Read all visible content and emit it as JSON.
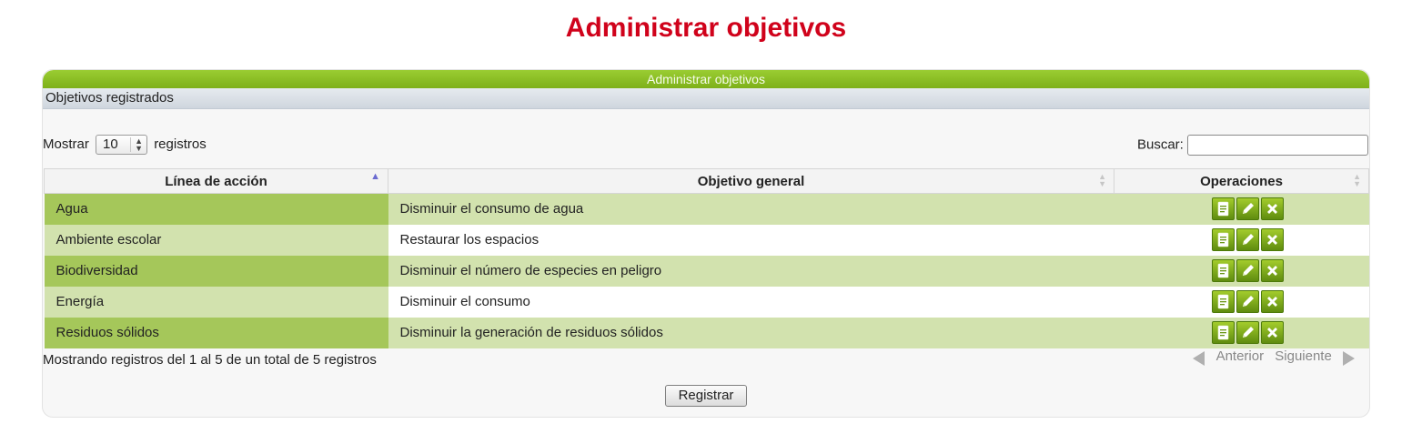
{
  "page": {
    "title": "Administrar objetivos"
  },
  "panel": {
    "header": "Administrar objetivos",
    "subheader": "Objetivos registrados"
  },
  "controls": {
    "show_label": "Mostrar",
    "page_size": "10",
    "records_label": "registros",
    "search_label": "Buscar:",
    "search_value": ""
  },
  "table": {
    "columns": [
      "Línea de acción",
      "Objetivo general",
      "Operaciones"
    ],
    "sorted_column": "Línea de acción",
    "sort_direction": "ascending",
    "rows": [
      {
        "linea": "Agua",
        "objetivo": "Disminuir el consumo de agua"
      },
      {
        "linea": "Ambiente escolar",
        "objetivo": "Restaurar los espacios"
      },
      {
        "linea": "Biodiversidad",
        "objetivo": "Disminuir el número de especies en peligro"
      },
      {
        "linea": "Energía",
        "objetivo": "Disminuir el consumo"
      },
      {
        "linea": "Residuos sólidos",
        "objetivo": "Disminuir la generación de residuos sólidos"
      }
    ],
    "operation_icons": [
      "document-icon",
      "edit-pencil-icon",
      "delete-x-icon"
    ]
  },
  "footer": {
    "info": "Mostrando registros del 1 al 5 de un total de 5 registros",
    "prev": "Anterior",
    "next": "Siguiente"
  },
  "actions": {
    "register": "Registrar"
  },
  "colors": {
    "title": "#d0021b",
    "header_green": "#8fc227",
    "row_odd": "#d2e2ae",
    "row_sorted_odd": "#a5c75a",
    "button_green": "#7fae1f"
  }
}
